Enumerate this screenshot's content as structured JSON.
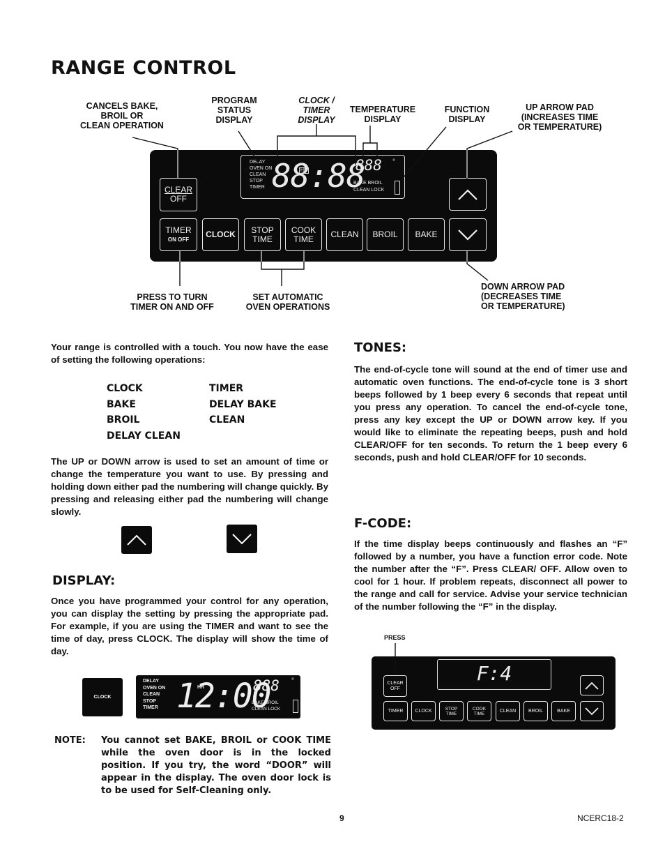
{
  "page": {
    "title": "RANGE CONTROL",
    "page_number": "9",
    "doc_code": "NCERC18-2"
  },
  "diagram": {
    "callouts": {
      "cancels": "CANCELS BAKE,\nBROIL OR\nCLEAN OPERATION",
      "program_status": "PROGRAM\nSTATUS\nDISPLAY",
      "clock_timer": "CLOCK /\nTIMER\nDISPLAY",
      "temperature": "TEMPERATURE\nDISPLAY",
      "function": "FUNCTION\nDISPLAY",
      "up_arrow": "UP ARROW PAD\n(INCREASES TIME\nOR TEMPERATURE)",
      "timer_onoff": "PRESS TO TURN\nTIMER ON AND OFF",
      "automatic": "SET AUTOMATIC\nOVEN OPERATIONS",
      "down_arrow": "DOWN ARROW PAD\n(DECREASES TIME\nOR TEMPERATURE)"
    },
    "lcd": {
      "status_labels": "DELAY\nOVEN ON\nCLEAN\nSTOP\nTIMER",
      "time": "88:88",
      "hr": "HR",
      "temp": "888",
      "degree": "°",
      "function_labels": "BAKE  BROIL\nCLEAN LOCK"
    },
    "pads": {
      "clear_off_top": "CLEAR",
      "clear_off_bottom": "OFF",
      "timer_top": "TIMER",
      "timer_bottom": "ON OFF",
      "clock": "CLOCK",
      "stop_top": "STOP",
      "stop_bottom": "TIME",
      "cook_top": "COOK",
      "cook_bottom": "TIME",
      "clean": "CLEAN",
      "broil": "BROIL",
      "bake": "BAKE",
      "up_icon": "chevron-up",
      "down_icon": "chevron-down"
    }
  },
  "left_column": {
    "intro": "Your range is controlled with a touch.  You now have the ease of setting the following operations:",
    "operations_col1": [
      "CLOCK",
      "BAKE",
      "BROIL",
      "DELAY CLEAN"
    ],
    "operations_col2": [
      "TIMER",
      "DELAY BAKE",
      "CLEAN"
    ],
    "arrows_text": {
      "p1": "The ",
      "b1": "UP",
      "p2": " or ",
      "b2": "DOWN",
      "p3": " arrow is used to set an amount of time or change the temperature you want to use.  By pressing and holding down either pad the numbering will change quickly.  By pressing and releasing either pad the numbering will change slowly."
    },
    "display_heading": "DISPLAY:",
    "display_text": {
      "p1": "Once you have programmed your control for any operation, you can display the setting by pressing the appropriate pad.  For example, if you are using the ",
      "b1": "TIMER",
      "p2": " and want to see the time of day, press ",
      "b2": "CLOCK",
      "p3": ". The display will show the time of day."
    },
    "example": {
      "clock_pad": "CLOCK",
      "status_labels": "DELAY\nOVEN ON\nCLEAN\nSTOP\nTIMER",
      "time": "12:00",
      "hr": "HR",
      "temp": "888",
      "degree": "°",
      "function_labels": "BAKE  BROIL\nCLEAN LOCK"
    },
    "note_label": "NOTE:",
    "note_text": "You cannot set BAKE, BROIL or COOK TIME while the oven door is in the locked position. If you try, the word “DOOR” will appear in the display.  The oven door lock is to be used for Self-Cleaning only."
  },
  "right_column": {
    "tones_heading": "TONES:",
    "tones_text": {
      "p1": "The end-of-cycle tone will sound at the end of timer use and automatic oven functions.  The end-of-cycle tone is 3 short beeps followed by 1 beep every 6 seconds that repeat until you press any operation.  To cancel the end-of-cycle tone, press any key except the ",
      "b1": "UP",
      "p2": " or ",
      "b2": "DOWN",
      "p3": " arrow key.  If you would like to eliminate the repeating beeps, push and hold ",
      "b3": "CLEAR/OFF",
      "p4": " for ten seconds.  To return the 1 beep every 6 seconds, push and hold ",
      "b4": "CLEAR/OFF",
      "p5": " for 10 seconds."
    },
    "fcode_heading": "F-CODE:",
    "fcode_text": {
      "p1": "If the time display beeps continuously and flashes an ",
      "b1": "“F”",
      "p2": " followed by a number, you have a function error code.  Note the number after the ",
      "b2": "“F”",
      "p3": ".  Press ",
      "b3": "CLEAR/ OFF",
      "p4": ".  Allow oven to cool for 1 hour.  If problem repeats, disconnect all power to the range and call for service. Advise your service technician of the number following the ",
      "b4": "“F”",
      "p5": " in the display."
    },
    "fcode_diagram": {
      "press_label": "PRESS",
      "display": "F:4",
      "clear_top": "CLEAR",
      "clear_bottom": "OFF",
      "pads": [
        "TIMER",
        "CLOCK",
        "STOP\nTIME",
        "COOK\nTIME",
        "CLEAN",
        "BROIL",
        "BAKE"
      ]
    }
  }
}
